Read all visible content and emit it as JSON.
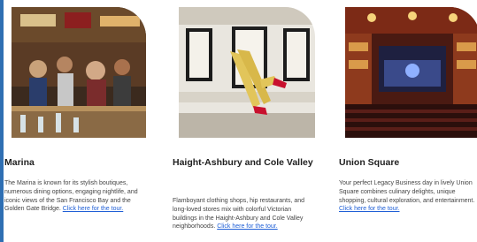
{
  "cards": [
    {
      "title": "Marina",
      "description": "The Marina is known for its stylish boutiques, numerous dining options, engaging nightlife, and iconic views of the San Francisco Bay and the Golden Gate Bridge.",
      "link_text": "Click here for the tour."
    },
    {
      "title": "Haight-Ashbury and Cole Valley",
      "description": "Flamboyant clothing shops, hip restaurants, and long-loved stores mix with colorful Victorian buildings in the Haight-Ashbury and Cole Valley neighborhoods.",
      "link_text": "Click here for the tour."
    },
    {
      "title": "Union Square",
      "description": "Your perfect Legacy Business day in lively Union Square combines culinary delights, unique shopping, cultural exploration, and entertainment.",
      "link_text": "Click here for the tour."
    }
  ],
  "colors": {
    "link": "#1f5fd6",
    "accent_edge": "#2f6fb3"
  }
}
